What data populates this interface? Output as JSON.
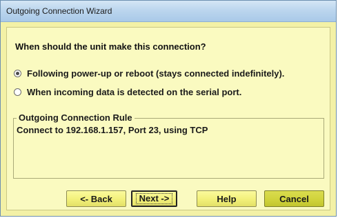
{
  "window": {
    "title": "Outgoing Connection Wizard"
  },
  "main": {
    "question": "When should the unit make this connection?",
    "options": [
      {
        "label": "Following power-up or reboot (stays connected indefinitely).",
        "selected": true
      },
      {
        "label": "When incoming data is detected on the serial port.",
        "selected": false
      }
    ],
    "rule_group": {
      "legend": "Outgoing Connection Rule",
      "text": "Connect to 192.168.1.157, Port 23, using TCP"
    }
  },
  "buttons": {
    "back": "<- Back",
    "next": "Next ->",
    "help": "Help",
    "cancel": "Cancel"
  },
  "colors": {
    "dialog_background": "#fafac0",
    "button_face": "#f2f07a",
    "cancel_face": "#cfd23a",
    "titlebar": "#bcd6ee"
  }
}
